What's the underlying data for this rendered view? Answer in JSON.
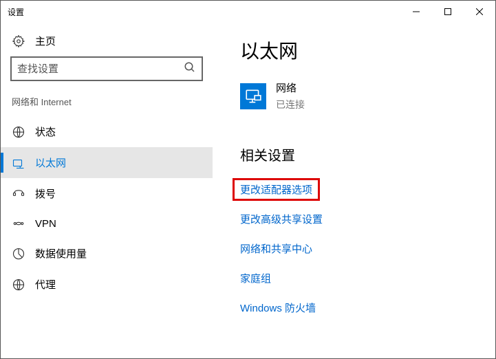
{
  "window": {
    "title": "设置"
  },
  "sidebar": {
    "home_label": "主页",
    "search_placeholder": "查找设置",
    "section_label": "网络和 Internet",
    "items": [
      {
        "label": "状态",
        "icon": "status-icon",
        "selected": false
      },
      {
        "label": "以太网",
        "icon": "ethernet-icon",
        "selected": true
      },
      {
        "label": "拨号",
        "icon": "dialup-icon",
        "selected": false
      },
      {
        "label": "VPN",
        "icon": "vpn-icon",
        "selected": false
      },
      {
        "label": "数据使用量",
        "icon": "data-icon",
        "selected": false
      },
      {
        "label": "代理",
        "icon": "proxy-icon",
        "selected": false
      }
    ]
  },
  "main": {
    "title": "以太网",
    "network": {
      "name": "网络",
      "status": "已连接"
    },
    "related": {
      "title": "相关设置",
      "links": [
        {
          "label": "更改适配器选项",
          "highlighted": true
        },
        {
          "label": "更改高级共享设置",
          "highlighted": false
        },
        {
          "label": "网络和共享中心",
          "highlighted": false
        },
        {
          "label": "家庭组",
          "highlighted": false
        },
        {
          "label": "Windows 防火墙",
          "highlighted": false
        }
      ]
    }
  }
}
